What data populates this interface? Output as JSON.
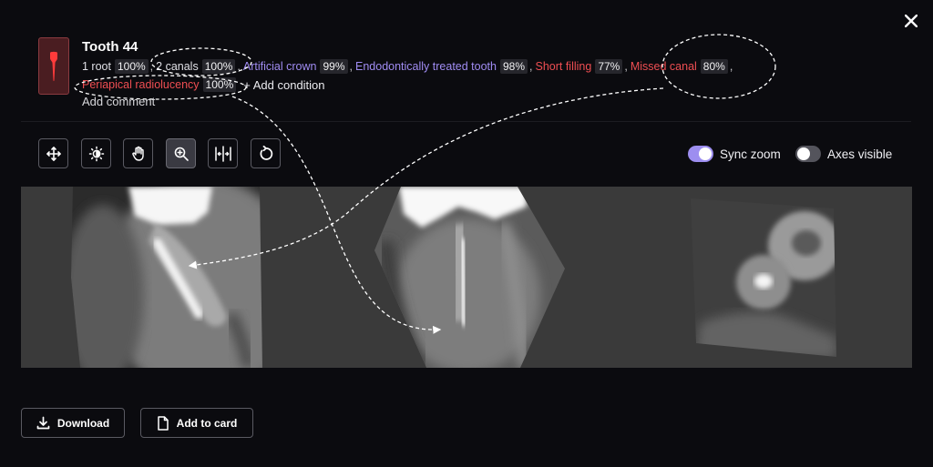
{
  "dialog": {
    "close_icon": "close-icon"
  },
  "tooth": {
    "title": "Tooth 44",
    "badge_icon": "tooth-icon",
    "badge_color": "#4a1d21",
    "conditions_row1": [
      {
        "label": "1 root",
        "pct": "100%",
        "color": "white"
      },
      {
        "label": "2 canals",
        "pct": "100%",
        "color": "white"
      },
      {
        "label": "Artificial crown",
        "pct": "99%",
        "color": "purple"
      },
      {
        "label": "Endodontically treated tooth",
        "pct": "98%",
        "color": "purple"
      },
      {
        "label": "Short filling",
        "pct": "77%",
        "color": "red"
      },
      {
        "label": "Missed canal",
        "pct": "80%",
        "color": "red"
      }
    ],
    "conditions_row2": [
      {
        "label": "Periapical radiolucency",
        "pct": "100%",
        "color": "red"
      }
    ],
    "separator": ",",
    "add_condition": "+ Add condition",
    "add_comment": "Add comment"
  },
  "toolbar": {
    "tools": [
      {
        "name": "move-icon",
        "active": false
      },
      {
        "name": "brightness-icon",
        "active": false
      },
      {
        "name": "pan-hand-icon",
        "active": false
      },
      {
        "name": "zoom-icon",
        "active": true
      },
      {
        "name": "split-view-icon",
        "active": false
      },
      {
        "name": "rotate-icon",
        "active": false
      }
    ],
    "sync_zoom": {
      "label": "Sync zoom",
      "on": true
    },
    "axes_visible": {
      "label": "Axes visible",
      "on": false
    }
  },
  "colors": {
    "accent": "#9d8ef0",
    "purple_text": "#a08cf2",
    "red_text": "#ef4e52",
    "viewer_bg": "#3a3a3a"
  },
  "actions": {
    "download": "Download",
    "download_icon": "download-icon",
    "add_to_card": "Add to card",
    "add_to_card_icon": "document-icon"
  }
}
